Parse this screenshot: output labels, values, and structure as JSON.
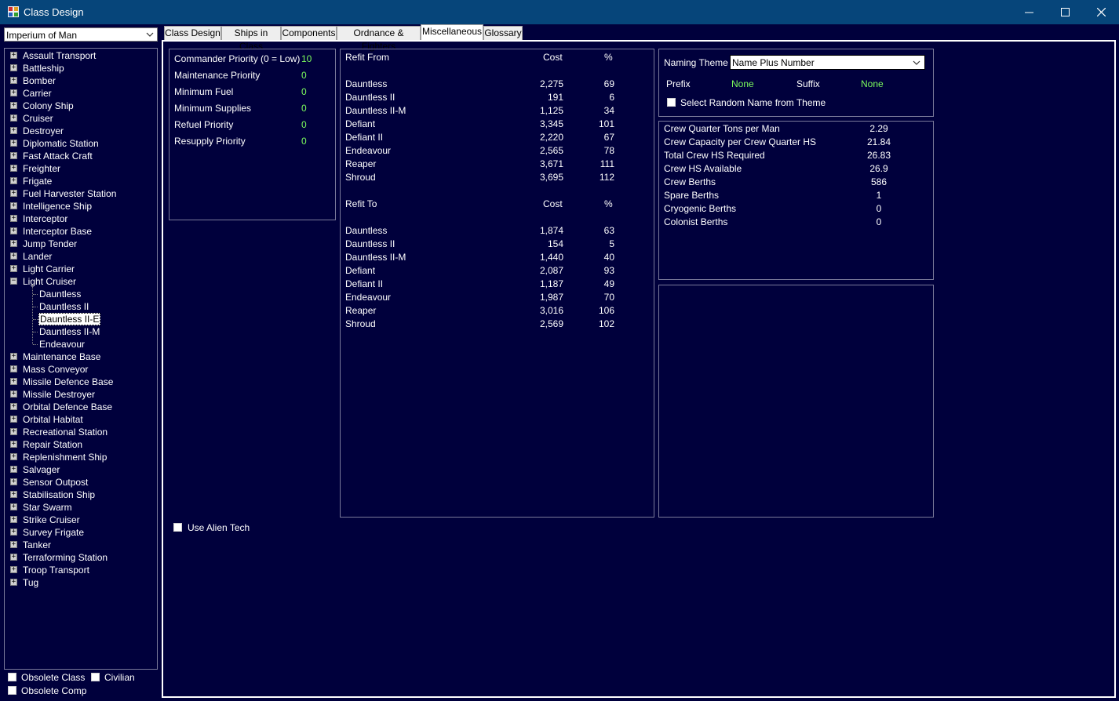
{
  "window": {
    "title": "Class Design",
    "minimize_icon": "minimize-icon",
    "maximize_icon": "maximize-icon",
    "close_icon": "close-icon"
  },
  "race_select": {
    "value": "Imperium of Man"
  },
  "tree": {
    "items_before": [
      "Assault Transport",
      "Battleship",
      "Bomber",
      "Carrier",
      "Colony Ship",
      "Cruiser",
      "Destroyer",
      "Diplomatic Station",
      "Fast Attack Craft",
      "Freighter",
      "Frigate",
      "Fuel Harvester Station",
      "Intelligence Ship",
      "Interceptor",
      "Interceptor Base",
      "Jump Tender",
      "Lander",
      "Light Carrier"
    ],
    "expanded": {
      "label": "Light Cruiser",
      "children": [
        "Dauntless",
        "Dauntless II",
        "Dauntless II-E",
        "Dauntless II-M",
        "Endeavour"
      ],
      "selected_index": 2
    },
    "items_after": [
      "Maintenance Base",
      "Mass Conveyor",
      "Missile Defence Base",
      "Missile Destroyer",
      "Orbital Defence Base",
      "Orbital Habitat",
      "Recreational Station",
      "Repair Station",
      "Replenishment Ship",
      "Salvager",
      "Sensor Outpost",
      "Stabilisation Ship",
      "Star Swarm",
      "Strike Cruiser",
      "Survey Frigate",
      "Tanker",
      "Terraforming Station",
      "Troop Transport",
      "Tug"
    ],
    "expand_symbol": "+",
    "collapse_symbol": "−"
  },
  "bottom_checks": {
    "obsolete_class": "Obsolete Class",
    "civilian": "Civilian",
    "obsolete_comp": "Obsolete Comp"
  },
  "tabs": [
    "Class Design",
    "Ships in Class",
    "Components",
    "Ordnance & Fighters",
    "Miscellaneous",
    "Glossary"
  ],
  "active_tab": 4,
  "priorities": [
    {
      "label": "Commander Priority (0 = Low)",
      "value": "10"
    },
    {
      "label": "Maintenance Priority",
      "value": "0"
    },
    {
      "label": "Minimum Fuel",
      "value": "0"
    },
    {
      "label": "Minimum Supplies",
      "value": "0"
    },
    {
      "label": "Refuel Priority",
      "value": "0"
    },
    {
      "label": "Resupply Priority",
      "value": "0"
    }
  ],
  "refit_from": {
    "headers": [
      "Refit From",
      "Cost",
      "%"
    ],
    "rows": [
      [
        "Dauntless",
        "2,275",
        "69"
      ],
      [
        "Dauntless II",
        "191",
        "6"
      ],
      [
        "Dauntless II-M",
        "1,125",
        "34"
      ],
      [
        "Defiant",
        "3,345",
        "101"
      ],
      [
        "Defiant II",
        "2,220",
        "67"
      ],
      [
        "Endeavour",
        "2,565",
        "78"
      ],
      [
        "Reaper",
        "3,671",
        "111"
      ],
      [
        "Shroud",
        "3,695",
        "112"
      ]
    ]
  },
  "refit_to": {
    "headers": [
      "Refit To",
      "Cost",
      "%"
    ],
    "rows": [
      [
        "Dauntless",
        "1,874",
        "63"
      ],
      [
        "Dauntless II",
        "154",
        "5"
      ],
      [
        "Dauntless II-M",
        "1,440",
        "40"
      ],
      [
        "Defiant",
        "2,087",
        "93"
      ],
      [
        "Defiant II",
        "1,187",
        "49"
      ],
      [
        "Endeavour",
        "1,987",
        "70"
      ],
      [
        "Reaper",
        "3,016",
        "106"
      ],
      [
        "Shroud",
        "2,569",
        "102"
      ]
    ]
  },
  "naming": {
    "label": "Naming Theme",
    "value": "Name Plus Number",
    "prefix_label": "Prefix",
    "prefix_value": "None",
    "suffix_label": "Suffix",
    "suffix_value": "None",
    "random_label": "Select Random Name from Theme"
  },
  "crew": [
    {
      "label": "Crew Quarter Tons per Man",
      "value": "2.29"
    },
    {
      "label": "Crew Capacity per Crew Quarter HS",
      "value": "21.84"
    },
    {
      "label": "Total Crew HS Required",
      "value": "26.83"
    },
    {
      "label": "Crew HS Available",
      "value": "26.9"
    },
    {
      "label": "Crew Berths",
      "value": "586"
    },
    {
      "label": "Spare Berths",
      "value": "1"
    },
    {
      "label": "Cryogenic Berths",
      "value": "0"
    },
    {
      "label": "Colonist Berths",
      "value": "0"
    }
  ],
  "alien_tech": {
    "label": "Use Alien Tech"
  }
}
